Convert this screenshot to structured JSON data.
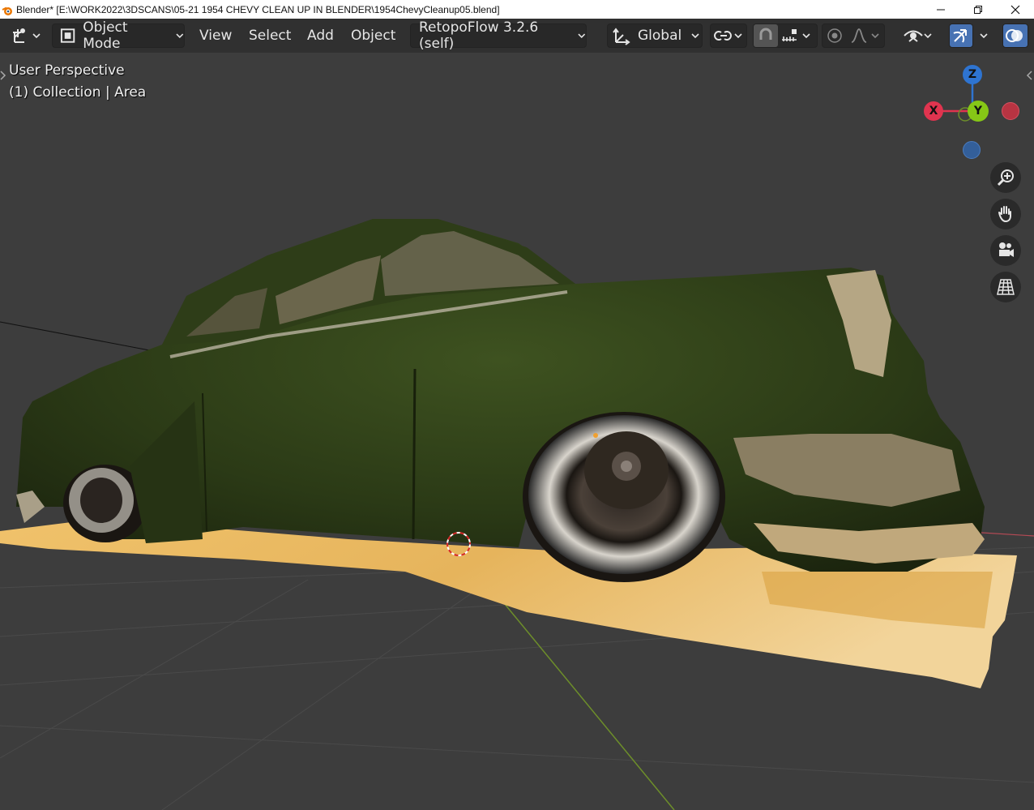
{
  "window": {
    "title": "Blender* [E:\\WORK2022\\3DSCANS\\05-21 1954 CHEVY CLEAN UP IN BLENDER\\1954ChevyCleanup05.blend]"
  },
  "header": {
    "mode_label": "Object Mode",
    "menus": [
      "View",
      "Select",
      "Add",
      "Object"
    ],
    "addon_label": "RetopoFlow 3.2.6 (self)",
    "orientation_label": "Global"
  },
  "viewport": {
    "perspective_label": "User Perspective",
    "collection_label": "(1) Collection | Area",
    "gizmo": {
      "z_label": "Z",
      "y_label": "Y",
      "x_label": "X"
    }
  },
  "colors": {
    "header_bg": "#303030",
    "viewport_bg": "#3d3d3d",
    "accent": "#4772b3",
    "axis_x": "#e0344f",
    "axis_y": "#86c716",
    "axis_z": "#2e74d1",
    "car_body": "#2f3f1a",
    "ground_scan": "#e8b862"
  },
  "icons": {
    "editor_type": "object-transform-icon",
    "mode": "object-mode-icon",
    "orientation": "transform-orientation-icon",
    "pivot": "pivot-link-icon",
    "snap": "snap-magnet-icon",
    "snap_target": "snap-increment-icon",
    "proportional": "proportional-edit-icon",
    "falloff": "falloff-curve-icon",
    "visibility": "eye-icon",
    "gizmo_toggle": "gizmo-icon",
    "overlay_toggle": "overlay-icon",
    "zoom": "zoom-icon",
    "pan": "hand-icon",
    "camera": "camera-icon",
    "ortho": "grid-perspective-icon"
  }
}
